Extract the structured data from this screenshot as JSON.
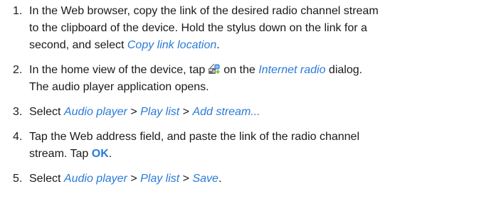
{
  "steps": [
    {
      "number": "1.",
      "line1": "In the Web browser, copy the link of the desired radio channel stream",
      "line2": "to the clipboard of the device. Hold the stylus down on the link for a",
      "line3_pre": "second, and select ",
      "line3_link": "Copy link location",
      "line3_post": "."
    },
    {
      "number": "2.",
      "pre": "In the home view of the device, tap",
      "icon": "internet-radio-icon",
      "mid": "on the ",
      "link": "Internet radio",
      "post": " dialog.",
      "line2": "The audio player application opens."
    },
    {
      "number": "3.",
      "pre": "Select ",
      "item1": "Audio player",
      "sep1": " > ",
      "item2": "Play list",
      "sep2": " > ",
      "item3": "Add stream..."
    },
    {
      "number": "4.",
      "line1": "Tap the Web address field, and paste the link of the radio channel",
      "line2_pre": "stream. Tap ",
      "line2_button": "OK",
      "line2_post": "."
    },
    {
      "number": "5.",
      "pre": "Select ",
      "item1": "Audio player",
      "sep1": " > ",
      "item2": "Play list",
      "sep2": " > ",
      "item3": "Save",
      "post": "."
    }
  ]
}
